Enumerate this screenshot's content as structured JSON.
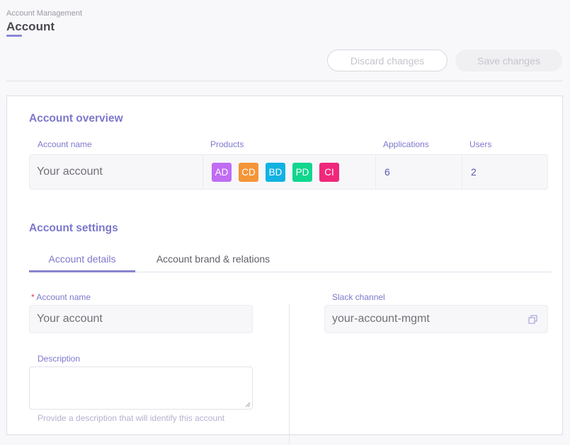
{
  "header": {
    "breadcrumb": "Account Management",
    "title": "Account",
    "discard_label": "Discard changes",
    "save_label": "Save changes"
  },
  "overview": {
    "title": "Account overview",
    "columns": {
      "account_name": "Account name",
      "products": "Products",
      "applications": "Applications",
      "users": "Users"
    },
    "account_name": "Your account",
    "products": [
      {
        "code": "AD",
        "color": "#c06cf4"
      },
      {
        "code": "CD",
        "color": "#f49538"
      },
      {
        "code": "BD",
        "color": "#12b2e2"
      },
      {
        "code": "PD",
        "color": "#10d68e"
      },
      {
        "code": "CI",
        "color": "#f0287c"
      }
    ],
    "applications": "6",
    "users": "2"
  },
  "settings": {
    "title": "Account settings",
    "tabs": [
      {
        "label": "Account details",
        "active": true
      },
      {
        "label": "Account brand & relations",
        "active": false
      }
    ],
    "account_name_label": "Account name",
    "required_mark": "*",
    "account_name_value": "Your account",
    "description_label": "Description",
    "description_value": "",
    "description_hint": "Provide a description that will identify this account",
    "slack_label": "Slack channel",
    "slack_value": "your-account-mgmt",
    "copy_icon": "copy-icon"
  }
}
